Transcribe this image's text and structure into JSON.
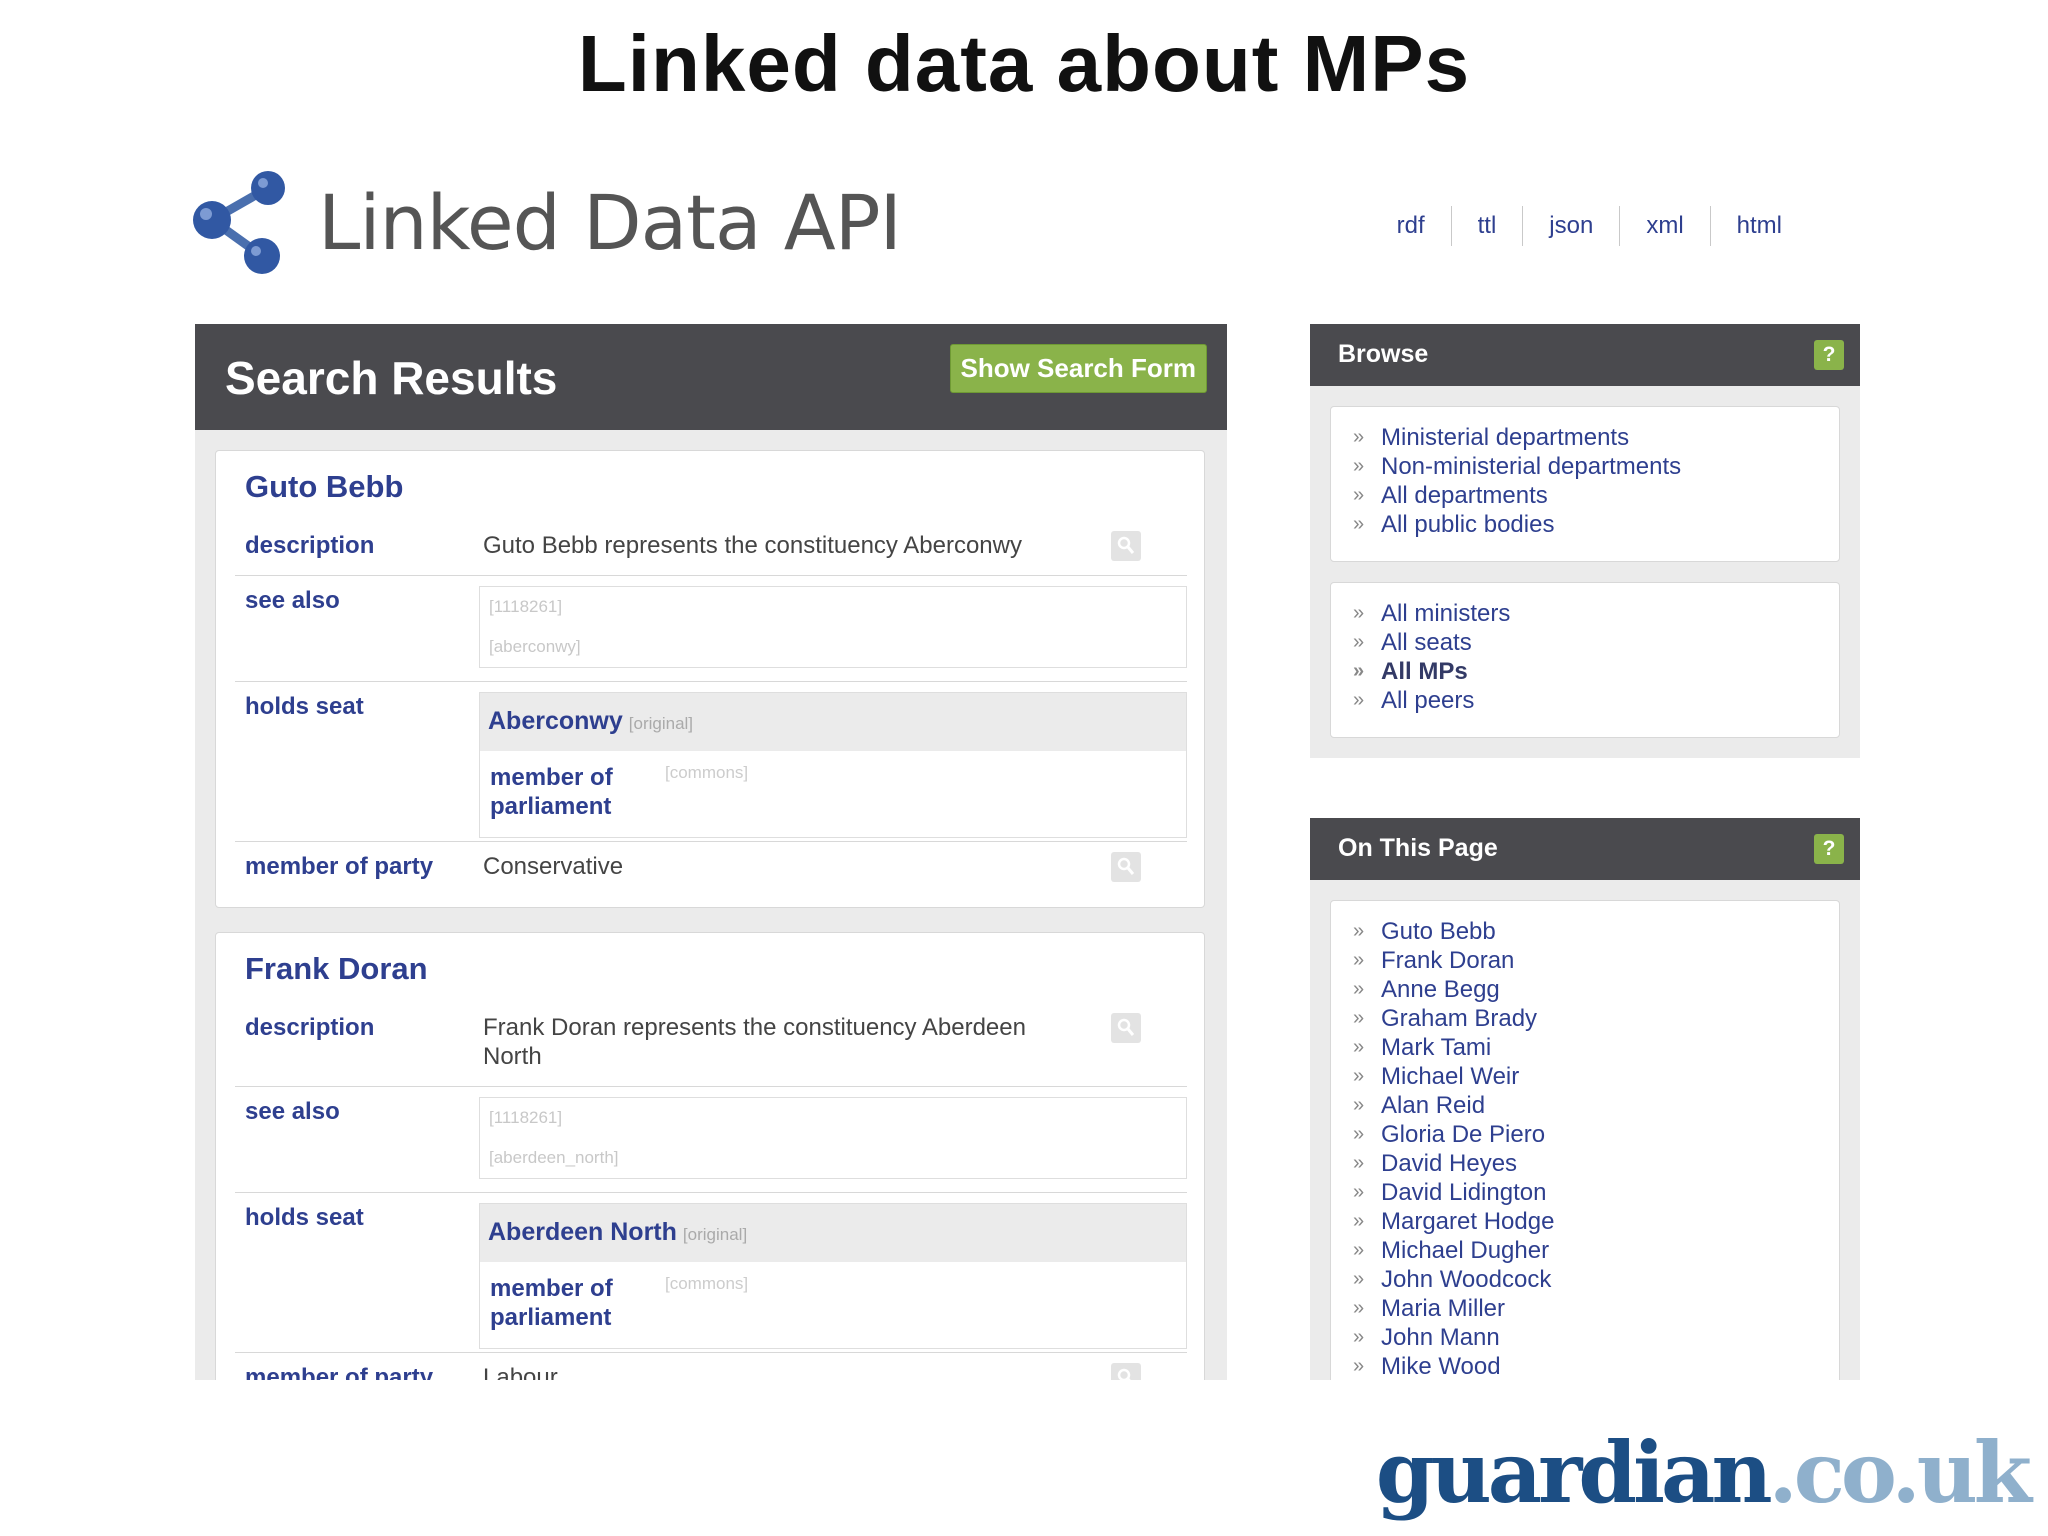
{
  "slide": {
    "title": "Linked data about MPs"
  },
  "header": {
    "logo_text": "Linked Data API",
    "formats": [
      "rdf",
      "ttl",
      "json",
      "xml",
      "html"
    ]
  },
  "results": {
    "title": "Search Results",
    "show_form_label": "Show Search Form",
    "mps": [
      {
        "name": "Guto Bebb",
        "description_label": "description",
        "description": "Guto Bebb represents the constituency Aberconwy",
        "see_also_label": "see also",
        "see_also": [
          "[1118261]",
          "[aberconwy]"
        ],
        "holds_seat_label": "holds seat",
        "seat": "Aberconwy",
        "seat_tag": "[original]",
        "seat_sub_label": "member of parliament",
        "seat_sub_tag": "[commons]",
        "party_label": "member of party",
        "party": "Conservative"
      },
      {
        "name": "Frank Doran",
        "description_label": "description",
        "description": "Frank Doran represents the constituency Aberdeen North",
        "see_also_label": "see also",
        "see_also": [
          "[1118261]",
          "[aberdeen_north]"
        ],
        "holds_seat_label": "holds seat",
        "seat": "Aberdeen North",
        "seat_tag": "[original]",
        "seat_sub_label": "member of parliament",
        "seat_sub_tag": "[commons]",
        "party_label": "member of party",
        "party": "Labour"
      }
    ]
  },
  "browse": {
    "title": "Browse",
    "help": "?",
    "group1": [
      "Ministerial departments",
      "Non-ministerial departments",
      "All departments",
      "All public bodies"
    ],
    "group2": [
      "All ministers",
      "All seats",
      "All MPs",
      "All peers"
    ]
  },
  "on_this_page": {
    "title": "On This Page",
    "help": "?",
    "items": [
      "Guto Bebb",
      "Frank Doran",
      "Anne Begg",
      "Graham Brady",
      "Mark Tami",
      "Michael Weir",
      "Alan Reid",
      "Gloria De Piero",
      "David Heyes",
      "David Lidington",
      "Margaret Hodge",
      "Michael Dugher",
      "John Woodcock",
      "Maria Miller",
      "John Mann",
      "Mike Wood"
    ]
  },
  "brand": {
    "main": "guardian",
    "suffix": ".co.uk"
  }
}
